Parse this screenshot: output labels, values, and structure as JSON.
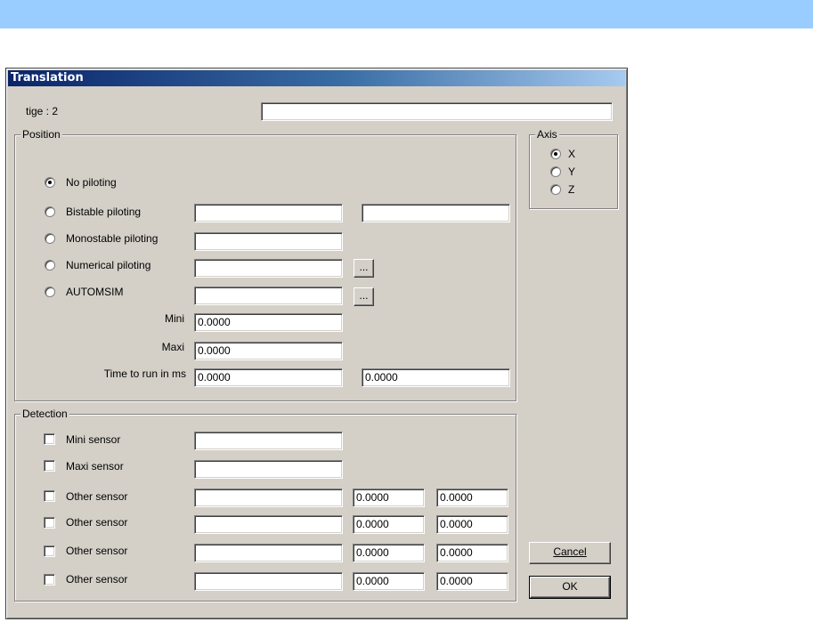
{
  "dialog": {
    "title": "Translation",
    "tige_label": "tige : 2",
    "tige_value": ""
  },
  "position": {
    "legend": "Position",
    "options": [
      {
        "label": "No piloting",
        "checked": true
      },
      {
        "label": "Bistable piloting",
        "checked": false
      },
      {
        "label": "Monostable piloting",
        "checked": false
      },
      {
        "label": "Numerical piloting",
        "checked": false
      },
      {
        "label": "AUTOMSIM",
        "checked": false
      }
    ],
    "bistable_value_1": "",
    "bistable_value_2": "",
    "monostable_value": "",
    "numerical_value": "",
    "automsim_value": "",
    "browse_label": "...",
    "mini_label": "Mini",
    "mini_value": "0.0000",
    "maxi_label": "Maxi",
    "maxi_value": "0.0000",
    "time_label": "Time to run in ms",
    "time_value_1": "0.0000",
    "time_value_2": "0.0000"
  },
  "axis": {
    "legend": "Axis",
    "options": [
      {
        "label": "X",
        "checked": true
      },
      {
        "label": "Y",
        "checked": false
      },
      {
        "label": "Z",
        "checked": false
      }
    ]
  },
  "detection": {
    "legend": "Detection",
    "mini_sensor": {
      "label": "Mini sensor",
      "value": ""
    },
    "maxi_sensor": {
      "label": "Maxi sensor",
      "value": ""
    },
    "other_sensors": [
      {
        "label": "Other sensor",
        "name": "",
        "v1": "0.0000",
        "v2": "0.0000"
      },
      {
        "label": "Other sensor",
        "name": "",
        "v1": "0.0000",
        "v2": "0.0000"
      },
      {
        "label": "Other sensor",
        "name": "",
        "v1": "0.0000",
        "v2": "0.0000"
      },
      {
        "label": "Other sensor",
        "name": "",
        "v1": "0.0000",
        "v2": "0.0000"
      }
    ]
  },
  "buttons": {
    "cancel": "Cancel",
    "ok": "OK"
  }
}
